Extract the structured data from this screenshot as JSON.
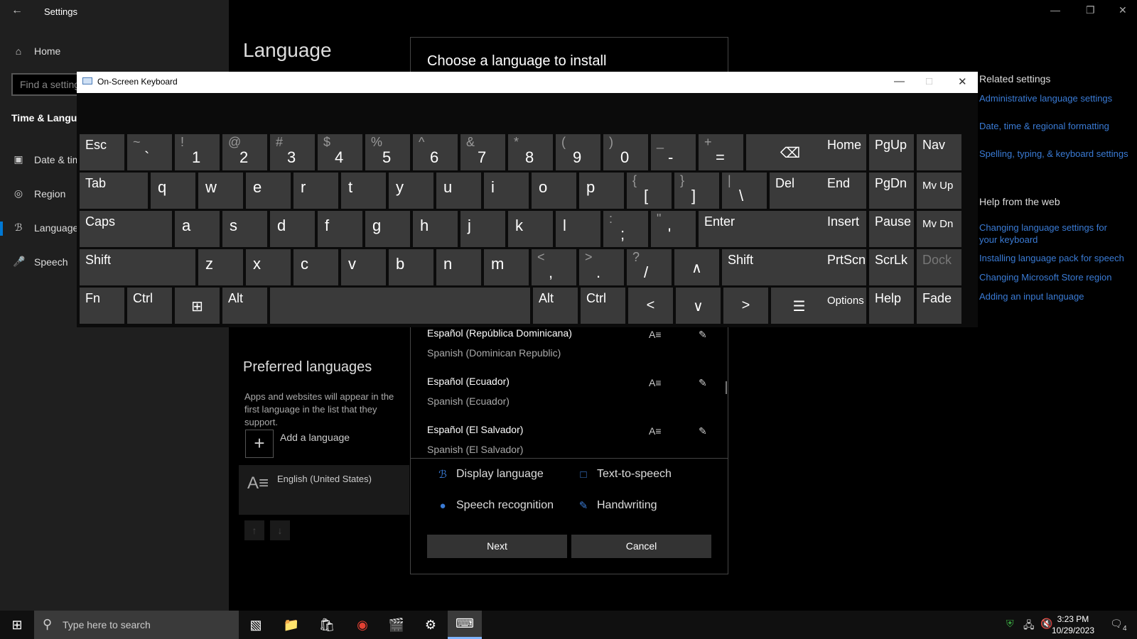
{
  "settings": {
    "window_title": "Settings",
    "search_placeholder": "Find a setting",
    "nav": {
      "home": "Home",
      "section": "Time & Language",
      "items": [
        "Date & time",
        "Region",
        "Language",
        "Speech"
      ]
    },
    "page_title": "Language",
    "preferred": {
      "title": "Preferred languages",
      "desc": "Apps and websites will appear in the first language in the list that they support.",
      "add_label": "Add a language",
      "lang_name": "English (United States)"
    },
    "related": {
      "head": "Related settings",
      "links": [
        "Administrative language settings",
        "Date, time & regional formatting",
        "Spelling, typing, & keyboard settings"
      ],
      "web_head": "Help from the web",
      "web_links": [
        "Changing language settings for your keyboard",
        "Installing language pack for speech",
        "Changing Microsoft Store region",
        "Adding an input language"
      ]
    }
  },
  "dialog": {
    "title": "Choose a language to install",
    "languages": [
      {
        "native": "Español (República Dominicana)",
        "english": "Spanish (Dominican Republic)"
      },
      {
        "native": "Español (Ecuador)",
        "english": "Spanish (Ecuador)"
      },
      {
        "native": "Español (El Salvador)",
        "english": "Spanish (El Salvador)"
      }
    ],
    "legend": {
      "display": "Display language",
      "tts": "Text-to-speech",
      "speech": "Speech recognition",
      "handwriting": "Handwriting"
    },
    "next": "Next",
    "cancel": "Cancel"
  },
  "osk": {
    "title": "On-Screen Keyboard",
    "row1": [
      [
        "~",
        "`"
      ],
      [
        "!",
        "1"
      ],
      [
        "@",
        "2"
      ],
      [
        "#",
        "3"
      ],
      [
        "$",
        "4"
      ],
      [
        "%",
        "5"
      ],
      [
        "^",
        "6"
      ],
      [
        "&",
        "7"
      ],
      [
        "*",
        "8"
      ],
      [
        "(",
        "9"
      ],
      [
        ")",
        "0"
      ],
      [
        "_",
        "-"
      ],
      [
        "+",
        "="
      ]
    ],
    "row2": [
      "q",
      "w",
      "e",
      "r",
      "t",
      "y",
      "u",
      "i",
      "o",
      "p"
    ],
    "row2_sym": [
      [
        "{",
        "["
      ],
      [
        "}",
        "]"
      ],
      [
        "|",
        "\\"
      ]
    ],
    "row3": [
      "a",
      "s",
      "d",
      "f",
      "g",
      "h",
      "j",
      "k",
      "l"
    ],
    "row3_sym": [
      [
        ":",
        ";"
      ],
      [
        "\"",
        "'"
      ]
    ],
    "row4": [
      "z",
      "x",
      "c",
      "v",
      "b",
      "n",
      "m"
    ],
    "row4_sym": [
      [
        "<",
        ","
      ],
      [
        ">",
        "."
      ],
      [
        "?",
        "/"
      ]
    ],
    "labels": {
      "esc": "Esc",
      "tab": "Tab",
      "caps": "Caps",
      "shift": "Shift",
      "fn": "Fn",
      "ctrl": "Ctrl",
      "alt": "Alt",
      "del": "Del",
      "enter": "Enter",
      "home": "Home",
      "pgup": "PgUp",
      "nav": "Nav",
      "end": "End",
      "pgdn": "PgDn",
      "mvup": "Mv Up",
      "insert": "Insert",
      "pause": "Pause",
      "mvdn": "Mv Dn",
      "prtscn": "PrtScn",
      "scrlk": "ScrLk",
      "dock": "Dock",
      "options": "Options",
      "help": "Help",
      "fade": "Fade"
    }
  },
  "taskbar": {
    "search_placeholder": "Type here to search",
    "time": "3:23 PM",
    "date": "10/29/2023",
    "notification_count": "4"
  }
}
